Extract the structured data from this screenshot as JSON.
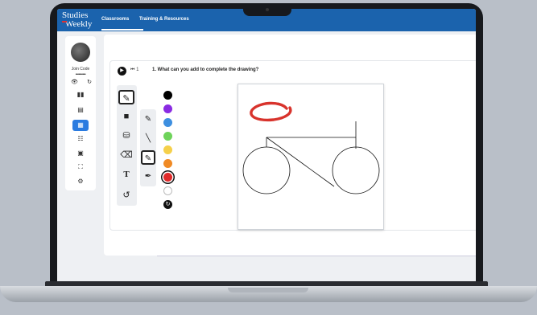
{
  "app": {
    "logo_line1": "Studies",
    "logo_line2": "Weekly"
  },
  "nav": {
    "tabs": [
      {
        "label": "Classrooms"
      },
      {
        "label": "Training & Resources"
      }
    ]
  },
  "sidebar": {
    "join_code_label": "Join Code",
    "join_code_value": "••••••••••",
    "icons": [
      "eye-icon",
      "refresh-icon",
      "book-icon",
      "gradebook-icon",
      "document-icon",
      "calendar-icon",
      "files-icon",
      "chart-icon",
      "settings-icon"
    ]
  },
  "question": {
    "step": "1",
    "text": "1. What can you add to complete the drawing?"
  },
  "palette": {
    "colors": [
      "#000000",
      "#8a2be2",
      "#3d8fe0",
      "#6ed35a",
      "#f5d04a",
      "#f08a24",
      "#e02a2a",
      "#ffffff"
    ],
    "selected_color": "#e02a2a"
  },
  "tools": [
    "pencil-icon",
    "square-icon",
    "fill-bucket-icon",
    "eraser-icon",
    "text-icon",
    "undo-icon"
  ],
  "pens": [
    "pen-icon",
    "line-icon",
    "brush-icon",
    "marker-icon"
  ]
}
